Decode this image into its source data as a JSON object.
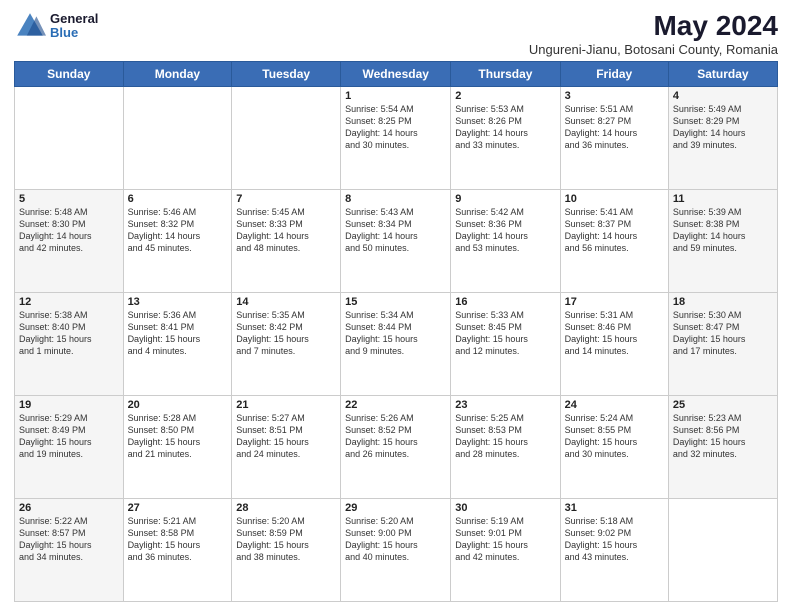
{
  "header": {
    "logo_general": "General",
    "logo_blue": "Blue",
    "month_title": "May 2024",
    "subtitle": "Ungureni-Jianu, Botosani County, Romania"
  },
  "weekdays": [
    "Sunday",
    "Monday",
    "Tuesday",
    "Wednesday",
    "Thursday",
    "Friday",
    "Saturday"
  ],
  "weeks": [
    [
      {
        "day": "",
        "info": ""
      },
      {
        "day": "",
        "info": ""
      },
      {
        "day": "",
        "info": ""
      },
      {
        "day": "1",
        "info": "Sunrise: 5:54 AM\nSunset: 8:25 PM\nDaylight: 14 hours\nand 30 minutes."
      },
      {
        "day": "2",
        "info": "Sunrise: 5:53 AM\nSunset: 8:26 PM\nDaylight: 14 hours\nand 33 minutes."
      },
      {
        "day": "3",
        "info": "Sunrise: 5:51 AM\nSunset: 8:27 PM\nDaylight: 14 hours\nand 36 minutes."
      },
      {
        "day": "4",
        "info": "Sunrise: 5:49 AM\nSunset: 8:29 PM\nDaylight: 14 hours\nand 39 minutes."
      }
    ],
    [
      {
        "day": "5",
        "info": "Sunrise: 5:48 AM\nSunset: 8:30 PM\nDaylight: 14 hours\nand 42 minutes."
      },
      {
        "day": "6",
        "info": "Sunrise: 5:46 AM\nSunset: 8:32 PM\nDaylight: 14 hours\nand 45 minutes."
      },
      {
        "day": "7",
        "info": "Sunrise: 5:45 AM\nSunset: 8:33 PM\nDaylight: 14 hours\nand 48 minutes."
      },
      {
        "day": "8",
        "info": "Sunrise: 5:43 AM\nSunset: 8:34 PM\nDaylight: 14 hours\nand 50 minutes."
      },
      {
        "day": "9",
        "info": "Sunrise: 5:42 AM\nSunset: 8:36 PM\nDaylight: 14 hours\nand 53 minutes."
      },
      {
        "day": "10",
        "info": "Sunrise: 5:41 AM\nSunset: 8:37 PM\nDaylight: 14 hours\nand 56 minutes."
      },
      {
        "day": "11",
        "info": "Sunrise: 5:39 AM\nSunset: 8:38 PM\nDaylight: 14 hours\nand 59 minutes."
      }
    ],
    [
      {
        "day": "12",
        "info": "Sunrise: 5:38 AM\nSunset: 8:40 PM\nDaylight: 15 hours\nand 1 minute."
      },
      {
        "day": "13",
        "info": "Sunrise: 5:36 AM\nSunset: 8:41 PM\nDaylight: 15 hours\nand 4 minutes."
      },
      {
        "day": "14",
        "info": "Sunrise: 5:35 AM\nSunset: 8:42 PM\nDaylight: 15 hours\nand 7 minutes."
      },
      {
        "day": "15",
        "info": "Sunrise: 5:34 AM\nSunset: 8:44 PM\nDaylight: 15 hours\nand 9 minutes."
      },
      {
        "day": "16",
        "info": "Sunrise: 5:33 AM\nSunset: 8:45 PM\nDaylight: 15 hours\nand 12 minutes."
      },
      {
        "day": "17",
        "info": "Sunrise: 5:31 AM\nSunset: 8:46 PM\nDaylight: 15 hours\nand 14 minutes."
      },
      {
        "day": "18",
        "info": "Sunrise: 5:30 AM\nSunset: 8:47 PM\nDaylight: 15 hours\nand 17 minutes."
      }
    ],
    [
      {
        "day": "19",
        "info": "Sunrise: 5:29 AM\nSunset: 8:49 PM\nDaylight: 15 hours\nand 19 minutes."
      },
      {
        "day": "20",
        "info": "Sunrise: 5:28 AM\nSunset: 8:50 PM\nDaylight: 15 hours\nand 21 minutes."
      },
      {
        "day": "21",
        "info": "Sunrise: 5:27 AM\nSunset: 8:51 PM\nDaylight: 15 hours\nand 24 minutes."
      },
      {
        "day": "22",
        "info": "Sunrise: 5:26 AM\nSunset: 8:52 PM\nDaylight: 15 hours\nand 26 minutes."
      },
      {
        "day": "23",
        "info": "Sunrise: 5:25 AM\nSunset: 8:53 PM\nDaylight: 15 hours\nand 28 minutes."
      },
      {
        "day": "24",
        "info": "Sunrise: 5:24 AM\nSunset: 8:55 PM\nDaylight: 15 hours\nand 30 minutes."
      },
      {
        "day": "25",
        "info": "Sunrise: 5:23 AM\nSunset: 8:56 PM\nDaylight: 15 hours\nand 32 minutes."
      }
    ],
    [
      {
        "day": "26",
        "info": "Sunrise: 5:22 AM\nSunset: 8:57 PM\nDaylight: 15 hours\nand 34 minutes."
      },
      {
        "day": "27",
        "info": "Sunrise: 5:21 AM\nSunset: 8:58 PM\nDaylight: 15 hours\nand 36 minutes."
      },
      {
        "day": "28",
        "info": "Sunrise: 5:20 AM\nSunset: 8:59 PM\nDaylight: 15 hours\nand 38 minutes."
      },
      {
        "day": "29",
        "info": "Sunrise: 5:20 AM\nSunset: 9:00 PM\nDaylight: 15 hours\nand 40 minutes."
      },
      {
        "day": "30",
        "info": "Sunrise: 5:19 AM\nSunset: 9:01 PM\nDaylight: 15 hours\nand 42 minutes."
      },
      {
        "day": "31",
        "info": "Sunrise: 5:18 AM\nSunset: 9:02 PM\nDaylight: 15 hours\nand 43 minutes."
      },
      {
        "day": "",
        "info": ""
      }
    ]
  ]
}
